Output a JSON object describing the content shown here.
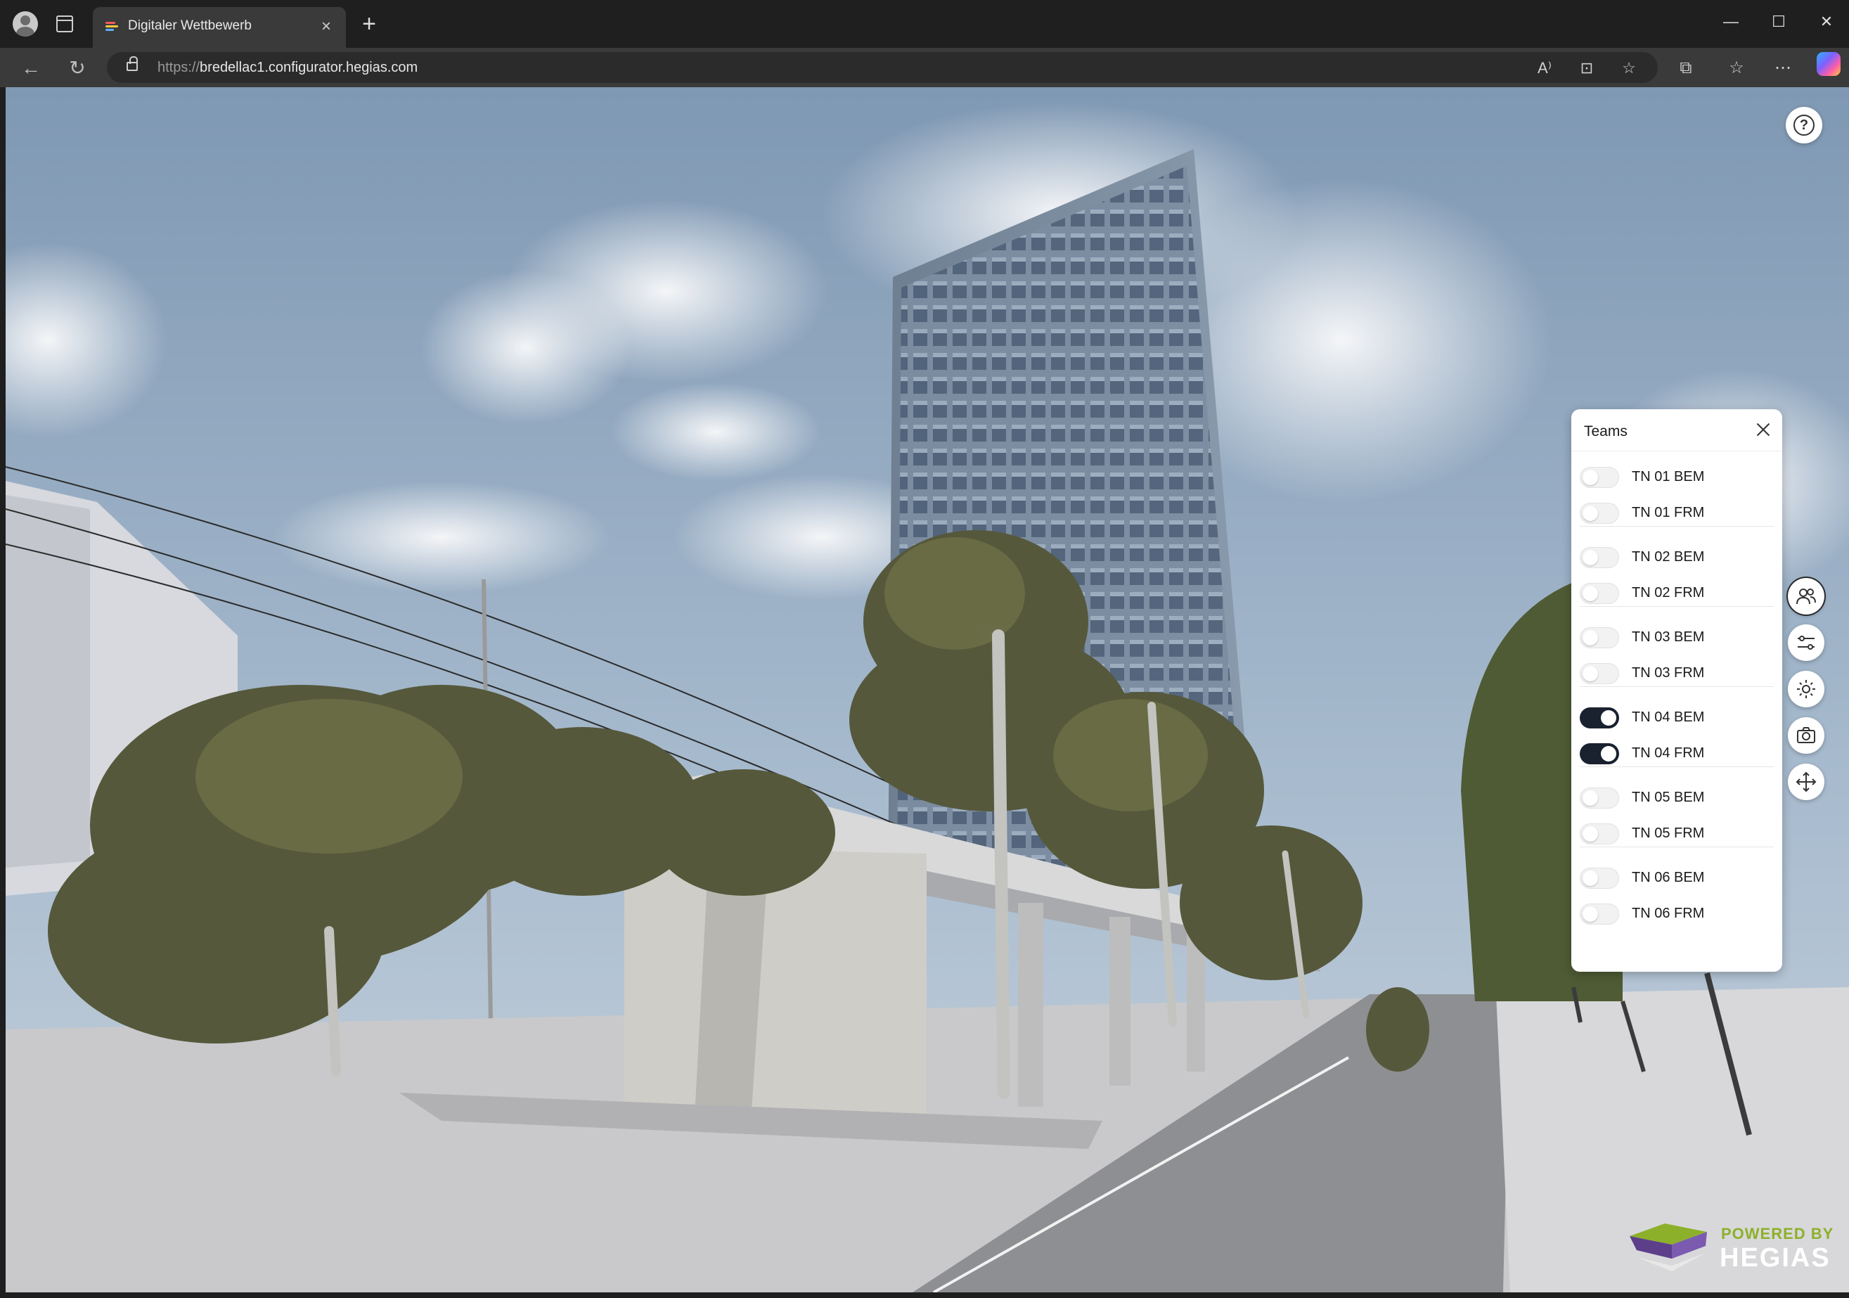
{
  "browser": {
    "tab_title": "Digitaler Wettbewerb",
    "url_protocol": "https://",
    "url_host": "bredellac1.configurator.hegias.com"
  },
  "teams_panel": {
    "title": "Teams",
    "groups": [
      {
        "items": [
          {
            "label": "TN 01 BEM",
            "on": false
          },
          {
            "label": "TN 01 FRM",
            "on": false
          }
        ]
      },
      {
        "items": [
          {
            "label": "TN 02 BEM",
            "on": false
          },
          {
            "label": "TN 02 FRM",
            "on": false
          }
        ]
      },
      {
        "items": [
          {
            "label": "TN 03 BEM",
            "on": false
          },
          {
            "label": "TN 03 FRM",
            "on": false
          }
        ]
      },
      {
        "items": [
          {
            "label": "TN 04 BEM",
            "on": true
          },
          {
            "label": "TN 04 FRM",
            "on": true
          }
        ]
      },
      {
        "items": [
          {
            "label": "TN 05 BEM",
            "on": false
          },
          {
            "label": "TN 05 FRM",
            "on": false
          }
        ]
      },
      {
        "items": [
          {
            "label": "TN 06 BEM",
            "on": false
          },
          {
            "label": "TN 06 FRM",
            "on": false
          }
        ]
      }
    ]
  },
  "tool_rail": [
    {
      "icon": "users-icon",
      "active": true
    },
    {
      "icon": "sliders-icon",
      "active": false
    },
    {
      "icon": "sun-icon",
      "active": false
    },
    {
      "icon": "camera-icon",
      "active": false
    },
    {
      "icon": "move-icon",
      "active": false
    }
  ],
  "help_icon": "help-icon",
  "logo": {
    "powered": "POWERED BY",
    "brand": "HEGIAS"
  },
  "colors": {
    "toggle_on": "#1a2230",
    "toggle_off": "#f2f2f2",
    "logo_green": "#8db02a"
  }
}
